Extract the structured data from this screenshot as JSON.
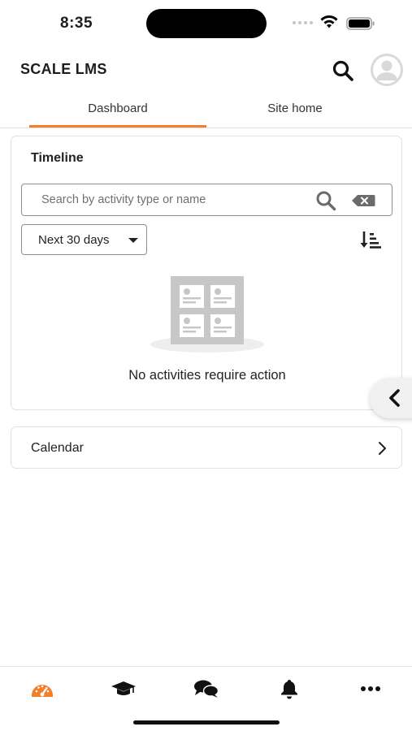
{
  "status_bar": {
    "time": "8:35"
  },
  "header": {
    "title": "SCALE LMS"
  },
  "tabs": [
    {
      "label": "Dashboard",
      "active": true
    },
    {
      "label": "Site home",
      "active": false
    }
  ],
  "timeline": {
    "title": "Timeline",
    "search": {
      "placeholder": "Search by activity type or name",
      "value": ""
    },
    "filter": {
      "selected": "Next 30 days"
    },
    "empty_message": "No activities require action"
  },
  "calendar": {
    "label": "Calendar"
  },
  "bottom_nav": [
    {
      "icon": "dashboard-gauge-icon",
      "active": true
    },
    {
      "icon": "graduation-cap-icon",
      "active": false
    },
    {
      "icon": "messages-icon",
      "active": false
    },
    {
      "icon": "bell-icon",
      "active": false
    },
    {
      "icon": "more-icon",
      "active": false
    }
  ],
  "colors": {
    "accent": "#f47f2b",
    "text": "#1d1d1f",
    "border": "#e2e2e2"
  }
}
